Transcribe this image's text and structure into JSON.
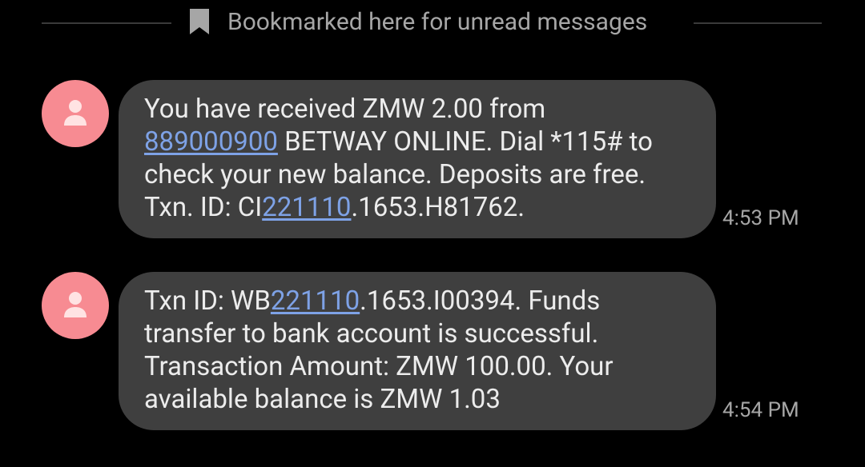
{
  "bookmark": {
    "icon": "bookmark-icon",
    "text": "Bookmarked here for unread messages"
  },
  "messages": [
    {
      "avatar_icon": "person-icon",
      "lines": [
        {
          "pre": "You have received ZMW 2.00 from",
          "link": "",
          "post": ""
        },
        {
          "pre": "",
          "link": "889000900",
          "post": " BETWAY ONLINE. Dial *115# to"
        },
        {
          "pre": "check your new balance. Deposits are free.",
          "link": "",
          "post": ""
        },
        {
          "pre": "Txn. ID: CI",
          "link": "221110",
          "post": ".1653.H81762."
        }
      ],
      "time": "4:53 PM"
    },
    {
      "avatar_icon": "person-icon",
      "lines": [
        {
          "pre": "Txn ID: WB",
          "link": "221110",
          "post": ".1653.I00394. Funds"
        },
        {
          "pre": "transfer to bank account is successful.",
          "link": "",
          "post": ""
        },
        {
          "pre": "Transaction Amount: ZMW 100.00. Your",
          "link": "",
          "post": ""
        },
        {
          "pre": "available balance is ZMW 1.03",
          "link": "",
          "post": ""
        }
      ],
      "time": "4:54 PM"
    }
  ],
  "colors": {
    "background": "#000000",
    "bubble": "#3f3f3f",
    "avatar": "#f78b92",
    "link": "#7ea2e6",
    "secondary_text": "#a6a6a6"
  }
}
